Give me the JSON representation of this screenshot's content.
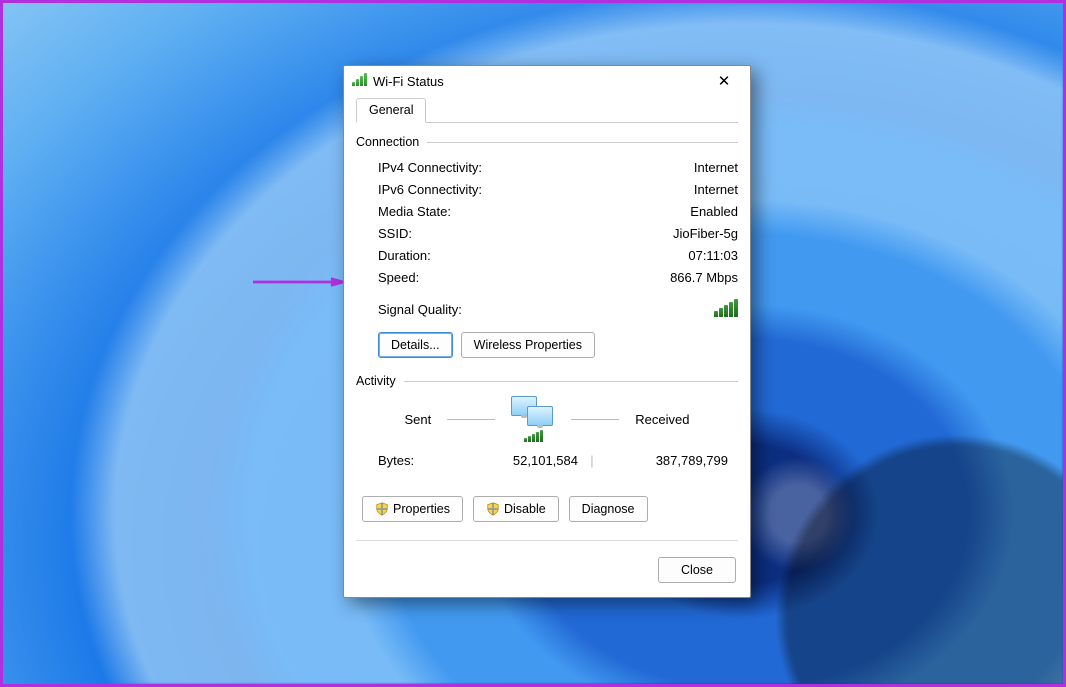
{
  "dialog": {
    "title": "Wi-Fi Status",
    "tab_general": "General",
    "connection_group": "Connection",
    "activity_group": "Activity"
  },
  "connection": {
    "ipv4_label": "IPv4 Connectivity:",
    "ipv4_value": "Internet",
    "ipv6_label": "IPv6 Connectivity:",
    "ipv6_value": "Internet",
    "media_label": "Media State:",
    "media_value": "Enabled",
    "ssid_label": "SSID:",
    "ssid_value": "JioFiber-5g",
    "duration_label": "Duration:",
    "duration_value": "07:11:03",
    "speed_label": "Speed:",
    "speed_value": "866.7 Mbps",
    "signal_label": "Signal Quality:"
  },
  "buttons": {
    "details": "Details...",
    "wireless_props": "Wireless Properties",
    "properties": "Properties",
    "disable": "Disable",
    "diagnose": "Diagnose",
    "close": "Close"
  },
  "activity": {
    "sent_label": "Sent",
    "received_label": "Received",
    "bytes_label": "Bytes:",
    "sent_bytes": "52,101,584",
    "received_bytes": "387,789,799"
  }
}
